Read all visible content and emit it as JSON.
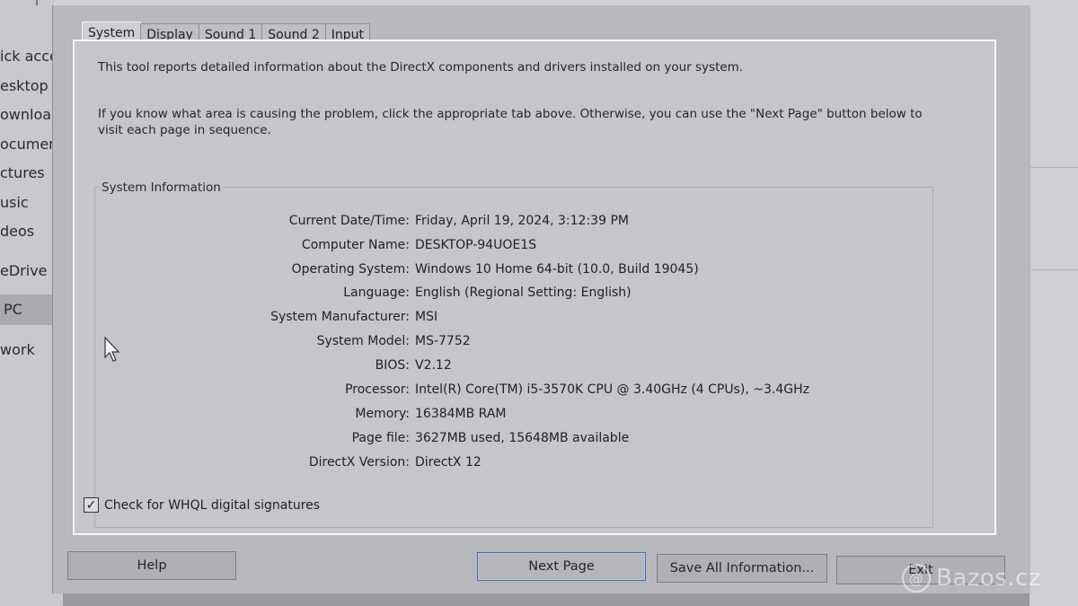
{
  "explorer": {
    "items": [
      {
        "label": "ick access"
      },
      {
        "label": "esktop"
      },
      {
        "label": "ownloads"
      },
      {
        "label": "ocuments"
      },
      {
        "label": "ctures"
      },
      {
        "label": "usic"
      },
      {
        "label": "deos"
      },
      {
        "label": "eDrive"
      },
      {
        "label": " PC",
        "selected": true
      },
      {
        "label": "work"
      }
    ]
  },
  "dialog": {
    "tabs": [
      {
        "label": "System",
        "active": true
      },
      {
        "label": "Display"
      },
      {
        "label": "Sound 1"
      },
      {
        "label": "Sound 2"
      },
      {
        "label": "Input"
      }
    ],
    "intro_line1": "This tool reports detailed information about the DirectX components and drivers installed on your system.",
    "intro_line2": "If you know what area is causing the problem, click the appropriate tab above.  Otherwise, you can use the \"Next Page\" button below to visit each page in sequence.",
    "system_info_title": "System Information",
    "system_info": [
      {
        "label": "Current Date/Time:",
        "value": "Friday, April 19, 2024, 3:12:39 PM"
      },
      {
        "label": "Computer Name:",
        "value": "DESKTOP-94UOE1S"
      },
      {
        "label": "Operating System:",
        "value": "Windows 10 Home 64-bit (10.0, Build 19045)"
      },
      {
        "label": "Language:",
        "value": "English (Regional Setting: English)"
      },
      {
        "label": "System Manufacturer:",
        "value": "MSI"
      },
      {
        "label": "System Model:",
        "value": "MS-7752"
      },
      {
        "label": "BIOS:",
        "value": "V2.12"
      },
      {
        "label": "Processor:",
        "value": "Intel(R) Core(TM) i5-3570K CPU @ 3.40GHz (4 CPUs), ~3.4GHz"
      },
      {
        "label": "Memory:",
        "value": "16384MB RAM"
      },
      {
        "label": "Page file:",
        "value": "3627MB used, 15648MB available"
      },
      {
        "label": "DirectX Version:",
        "value": "DirectX 12"
      }
    ],
    "whql_label": "Check for WHQL digital signatures",
    "whql_checked": true,
    "buttons": {
      "help": "Help",
      "next_page": "Next Page",
      "save_all": "Save All Information...",
      "exit": "Exit"
    }
  },
  "watermark": {
    "symbol": "@",
    "text": "Bazos.cz"
  }
}
